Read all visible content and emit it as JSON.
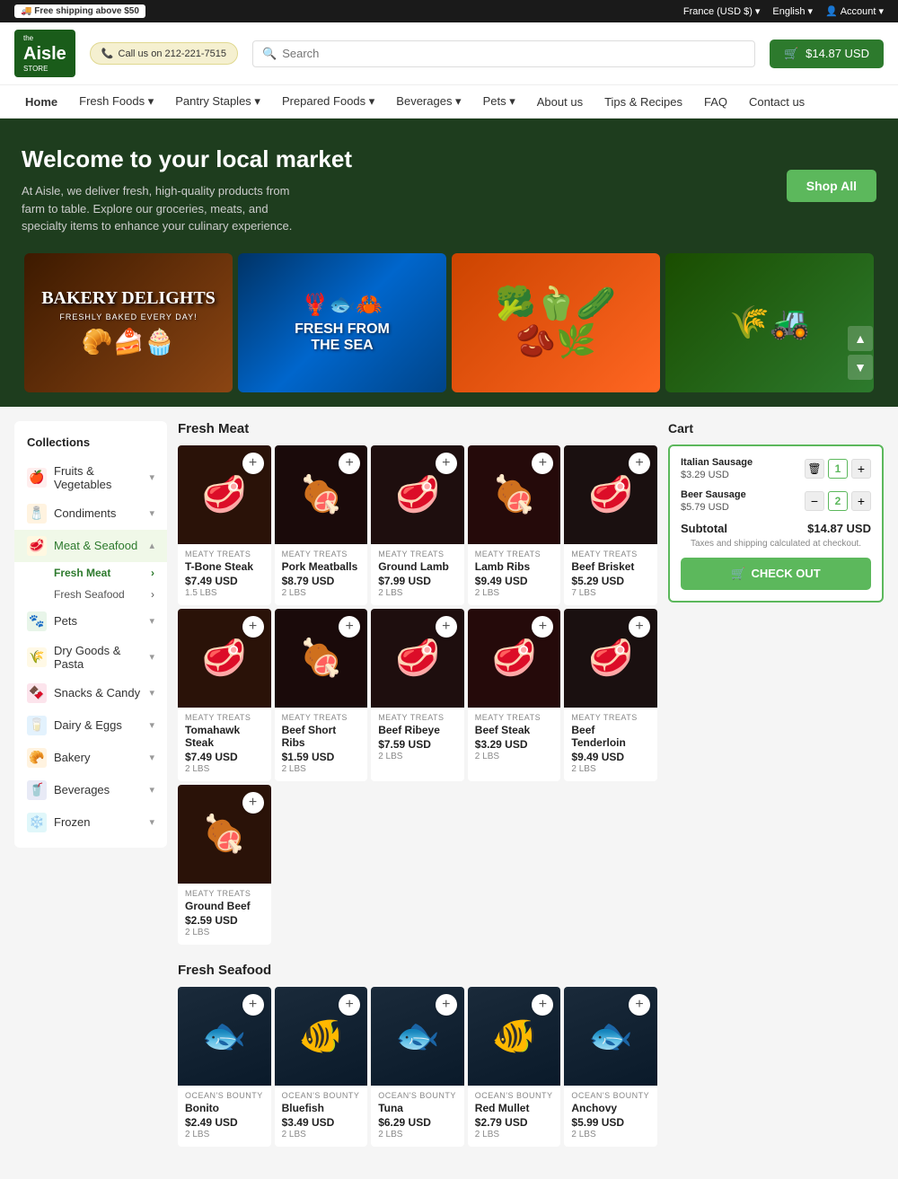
{
  "topbar": {
    "free_shipping": "🚚 Free shipping above $50",
    "country": "France (USD $)",
    "language": "English",
    "account": "Account"
  },
  "header": {
    "logo_the": "the",
    "logo_aisle": "Aisle",
    "logo_store": "STORE",
    "phone_label": "Call us on 212-221-7515",
    "search_placeholder": "Search",
    "cart_total": "$14.87 USD"
  },
  "nav": {
    "items": [
      {
        "label": "Home",
        "active": true
      },
      {
        "label": "Fresh Foods",
        "has_dropdown": true
      },
      {
        "label": "Pantry Staples",
        "has_dropdown": true
      },
      {
        "label": "Prepared Foods",
        "has_dropdown": true
      },
      {
        "label": "Beverages",
        "has_dropdown": true
      },
      {
        "label": "Pets",
        "has_dropdown": true
      },
      {
        "label": "About us"
      },
      {
        "label": "Tips & Recipes"
      },
      {
        "label": "FAQ"
      },
      {
        "label": "Contact us"
      }
    ]
  },
  "hero": {
    "title": "Welcome to your local market",
    "description": "At Aisle, we deliver fresh, high-quality products from farm to table. Explore our groceries, meats, and specialty items to enhance your culinary experience.",
    "shop_all": "Shop All"
  },
  "banners": [
    {
      "title": "BAKERY DELIGHTS",
      "subtitle": "FRESHLY BAKED EVERY DAY!",
      "type": "bakery"
    },
    {
      "title": "FRESH FROM THE SEA",
      "subtitle": "",
      "type": "sea"
    },
    {
      "title": "",
      "subtitle": "",
      "type": "veggies"
    },
    {
      "title": "",
      "subtitle": "",
      "type": "farm"
    }
  ],
  "sidebar": {
    "title": "Collections",
    "items": [
      {
        "label": "Fruits & Vegetables",
        "icon": "🍎",
        "has_dropdown": true,
        "bg": "#ffeeee"
      },
      {
        "label": "Condiments",
        "icon": "🧂",
        "has_dropdown": true,
        "bg": "#fff3e0"
      },
      {
        "label": "Meat & Seafood",
        "icon": "🥩",
        "active": true,
        "has_dropdown": true,
        "bg": "#fff8e1",
        "sub": [
          {
            "label": "Fresh Meat",
            "active": true
          },
          {
            "label": "Fresh Seafood"
          }
        ]
      },
      {
        "label": "Pets",
        "icon": "🐾",
        "has_dropdown": true,
        "bg": "#e8f5e9"
      },
      {
        "label": "Dry Goods & Pasta",
        "icon": "🌾",
        "has_dropdown": true,
        "bg": "#fff9e6"
      },
      {
        "label": "Snacks & Candy",
        "icon": "🍫",
        "has_dropdown": true,
        "bg": "#fce4ec"
      },
      {
        "label": "Dairy & Eggs",
        "icon": "🥛",
        "has_dropdown": true,
        "bg": "#e3f2fd"
      },
      {
        "label": "Bakery",
        "icon": "🥐",
        "has_dropdown": true,
        "bg": "#fff3e0"
      },
      {
        "label": "Beverages",
        "icon": "🥤",
        "has_dropdown": true,
        "bg": "#e8eaf6"
      },
      {
        "label": "Frozen",
        "icon": "❄️",
        "has_dropdown": true,
        "bg": "#e0f7fa"
      }
    ]
  },
  "fresh_meat": {
    "title": "Fresh Meat",
    "products": [
      {
        "brand": "MEATY TREATS",
        "name": "T-Bone Steak",
        "price": "$7.49 USD",
        "weight": "1.5 LBS",
        "emoji": "🥩"
      },
      {
        "brand": "MEATY TREATS",
        "name": "Pork Meatballs",
        "price": "$8.79 USD",
        "weight": "2 LBS",
        "emoji": "🍖"
      },
      {
        "brand": "MEATY TREATS",
        "name": "Ground Lamb",
        "price": "$7.99 USD",
        "weight": "2 LBS",
        "emoji": "🥩"
      },
      {
        "brand": "MEATY TREATS",
        "name": "Lamb Ribs",
        "price": "$9.49 USD",
        "weight": "2 LBS",
        "emoji": "🍖"
      },
      {
        "brand": "MEATY TREATS",
        "name": "Beef Brisket",
        "price": "$5.29 USD",
        "weight": "7 LBS",
        "emoji": "🥩"
      },
      {
        "brand": "MEATY TREATS",
        "name": "Tomahawk Steak",
        "price": "$7.49 USD",
        "weight": "2 LBS",
        "emoji": "🥩"
      },
      {
        "brand": "MEATY TREATS",
        "name": "Beef Short Ribs",
        "price": "$1.59 USD",
        "weight": "2 LBS",
        "emoji": "🍖"
      },
      {
        "brand": "MEATY TREATS",
        "name": "Beef Ribeye",
        "price": "$7.59 USD",
        "weight": "2 LBS",
        "emoji": "🥩"
      },
      {
        "brand": "MEATY TREATS",
        "name": "Beef Steak",
        "price": "$3.29 USD",
        "weight": "2 LBS",
        "emoji": "🥩"
      },
      {
        "brand": "MEATY TREATS",
        "name": "Beef Tenderloin",
        "price": "$9.49 USD",
        "weight": "2 LBS",
        "emoji": "🥩"
      },
      {
        "brand": "MEATY TREATS",
        "name": "Ground Beef",
        "price": "$2.59 USD",
        "weight": "2 LBS",
        "emoji": "🍖"
      }
    ]
  },
  "fresh_seafood": {
    "title": "Fresh Seafood",
    "products": [
      {
        "brand": "OCEAN'S BOUNTY",
        "name": "Bonito",
        "price": "$2.49 USD",
        "weight": "2 LBS",
        "emoji": "🐟"
      },
      {
        "brand": "OCEAN'S BOUNTY",
        "name": "Bluefish",
        "price": "$3.49 USD",
        "weight": "2 LBS",
        "emoji": "🐠"
      },
      {
        "brand": "OCEAN'S BOUNTY",
        "name": "Tuna",
        "price": "$6.29 USD",
        "weight": "2 LBS",
        "emoji": "🐟"
      },
      {
        "brand": "OCEAN'S BOUNTY",
        "name": "Red Mullet",
        "price": "$2.79 USD",
        "weight": "2 LBS",
        "emoji": "🐠"
      },
      {
        "brand": "OCEAN'S BOUNTY",
        "name": "Anchovy",
        "price": "$5.99 USD",
        "weight": "2 LBS",
        "emoji": "🐟"
      }
    ]
  },
  "cart": {
    "title": "Cart",
    "items": [
      {
        "name": "Italian Sausage",
        "price": "$3.29 USD",
        "qty": 1
      },
      {
        "name": "Beer Sausage",
        "price": "$5.79 USD",
        "qty": 2
      }
    ],
    "subtotal_label": "Subtotal",
    "subtotal": "$14.87 USD",
    "tax_note": "Taxes and shipping calculated at checkout.",
    "checkout_label": "CHECK OUT"
  }
}
